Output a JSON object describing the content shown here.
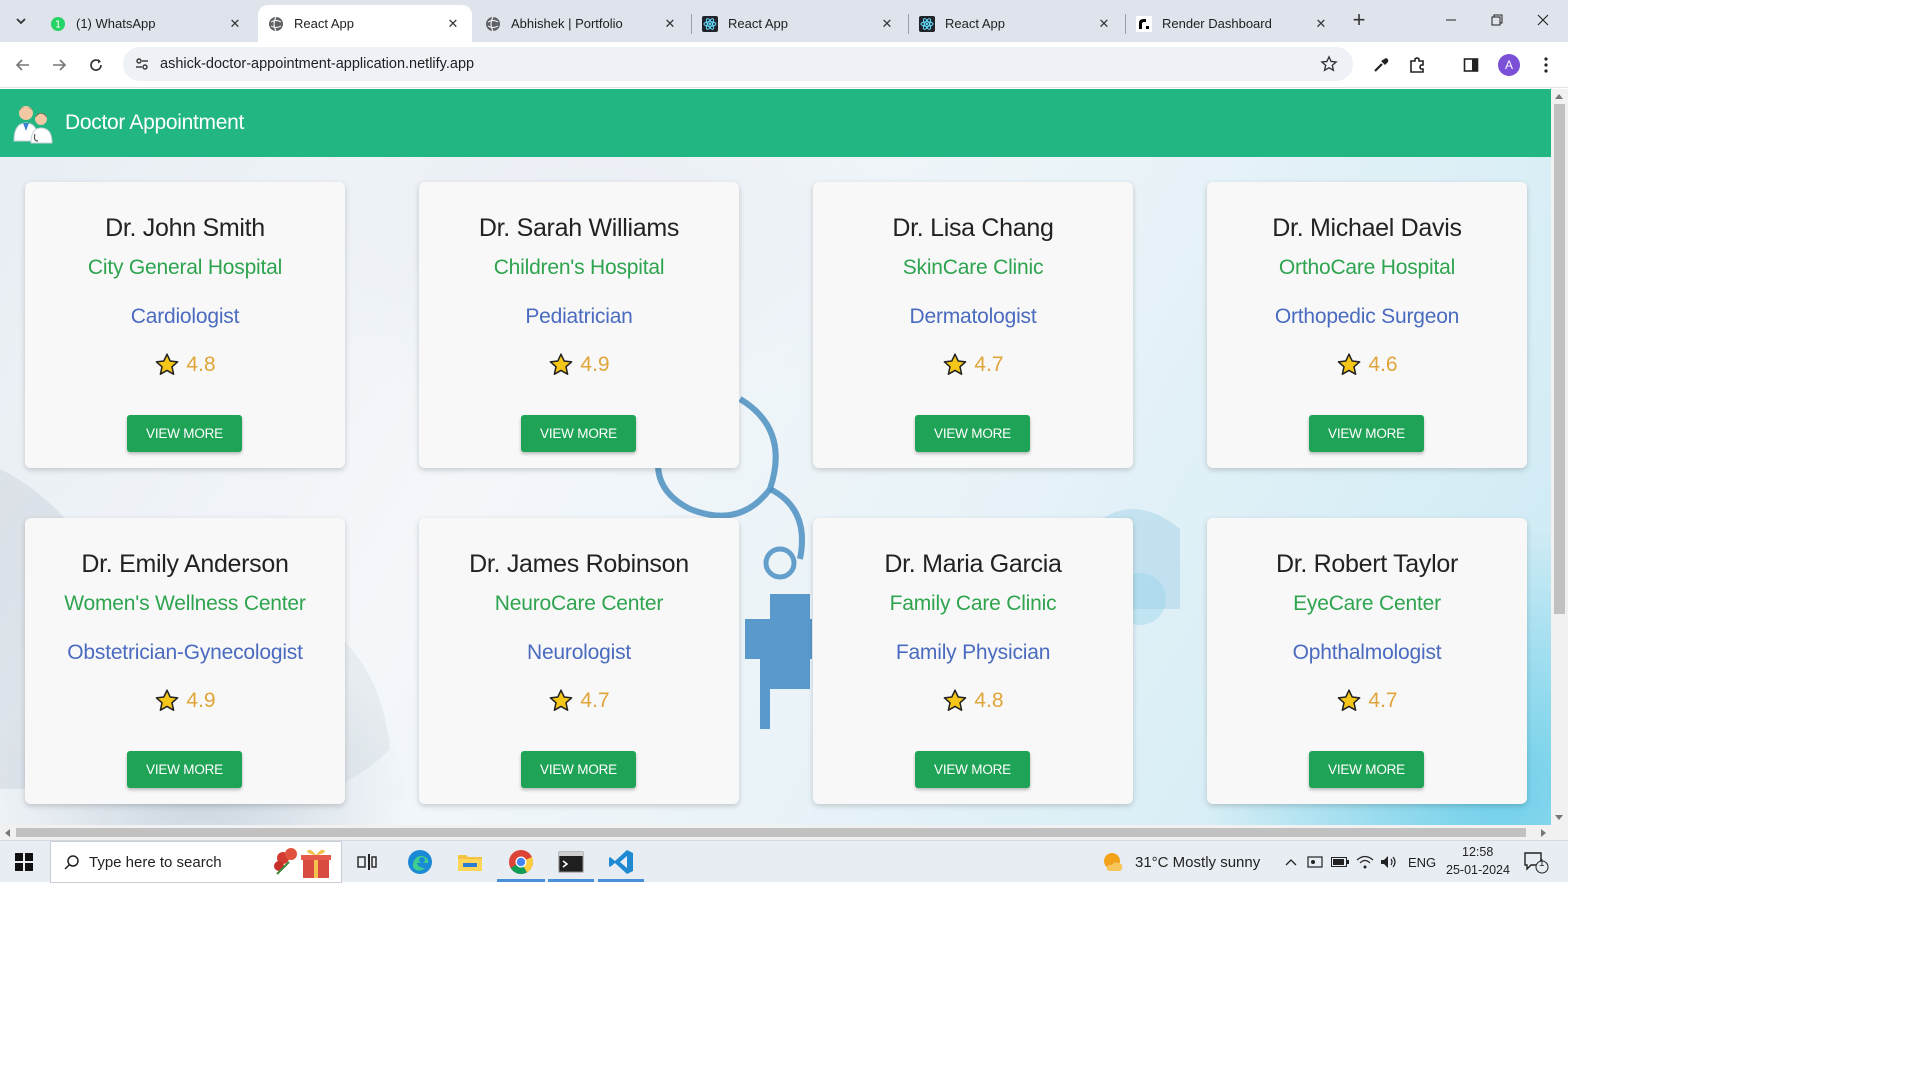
{
  "browser": {
    "tabs": [
      {
        "title": "(1) WhatsApp",
        "icon": "whatsapp-icon",
        "active": false
      },
      {
        "title": "React App",
        "icon": "globe-icon",
        "active": true
      },
      {
        "title": "Abhishek | Portfolio",
        "icon": "globe-icon",
        "active": false
      },
      {
        "title": "React App",
        "icon": "react-icon",
        "active": false
      },
      {
        "title": "React App",
        "icon": "react-icon",
        "active": false
      },
      {
        "title": "Render Dashboard",
        "icon": "render-icon",
        "active": false
      }
    ],
    "url": "ashick-doctor-appointment-application.netlify.app",
    "profile_initial": "A"
  },
  "app": {
    "title": "Doctor Appointment",
    "brand_color": "#21b682"
  },
  "doctors": [
    {
      "name": "Dr. John Smith",
      "hospital": "City General Hospital",
      "specialty": "Cardiologist",
      "rating": "4.8",
      "button": "VIEW MORE"
    },
    {
      "name": "Dr. Sarah Williams",
      "hospital": "Children's Hospital",
      "specialty": "Pediatrician",
      "rating": "4.9",
      "button": "VIEW MORE"
    },
    {
      "name": "Dr. Lisa Chang",
      "hospital": "SkinCare Clinic",
      "specialty": "Dermatologist",
      "rating": "4.7",
      "button": "VIEW MORE"
    },
    {
      "name": "Dr. Michael Davis",
      "hospital": "OrthoCare Hospital",
      "specialty": "Orthopedic Surgeon",
      "rating": "4.6",
      "button": "VIEW MORE"
    },
    {
      "name": "Dr. Emily Anderson",
      "hospital": "Women's Wellness Center",
      "specialty": "Obstetrician-Gynecologist",
      "rating": "4.9",
      "button": "VIEW MORE"
    },
    {
      "name": "Dr. James Robinson",
      "hospital": "NeuroCare Center",
      "specialty": "Neurologist",
      "rating": "4.7",
      "button": "VIEW MORE"
    },
    {
      "name": "Dr. Maria Garcia",
      "hospital": "Family Care Clinic",
      "specialty": "Family Physician",
      "rating": "4.8",
      "button": "VIEW MORE"
    },
    {
      "name": "Dr. Robert Taylor",
      "hospital": "EyeCare Center",
      "specialty": "Ophthalmologist",
      "rating": "4.7",
      "button": "VIEW MORE"
    }
  ],
  "taskbar": {
    "search_placeholder": "Type here to search",
    "weather": "31°C  Mostly sunny",
    "language": "ENG",
    "time": "12:58",
    "date": "25-01-2024",
    "notification_count": "1"
  }
}
